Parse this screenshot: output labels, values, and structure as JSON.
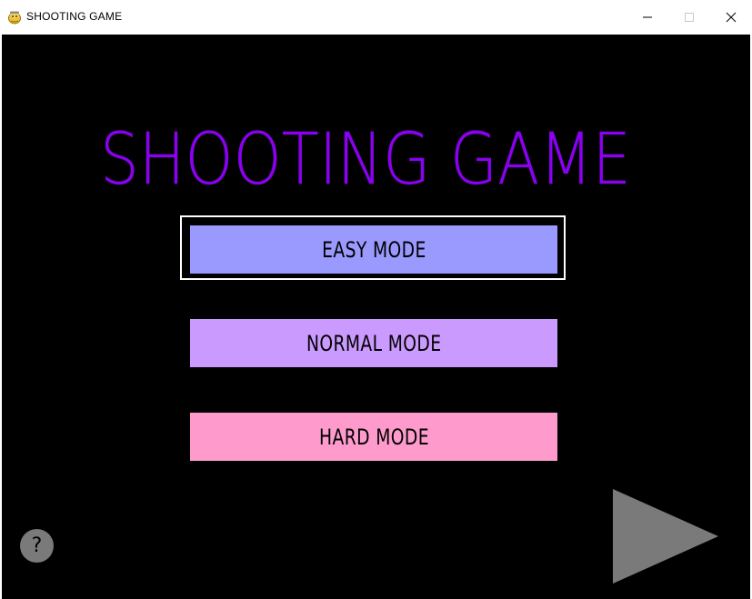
{
  "window": {
    "title": "SHOOTING GAME",
    "icon": "pygame-snake-icon",
    "controls": {
      "minimize": "minimize-icon",
      "maximize": "maximize-icon",
      "close": "close-icon"
    }
  },
  "game": {
    "title": "SHOOTING GAME",
    "title_color": "#8a00f0",
    "background": "#000000",
    "modes": [
      {
        "label": "EASY MODE",
        "color": "#9a99fe",
        "selected": true
      },
      {
        "label": "NORMAL MODE",
        "color": "#cb9afe",
        "selected": false
      },
      {
        "label": "HARD MODE",
        "color": "#fe9bcc",
        "selected": false
      }
    ],
    "help": {
      "label": "?",
      "icon": "help-icon",
      "color": "#7a7a7a"
    },
    "play": {
      "icon": "play-triangle-icon",
      "color": "#7a7a7a"
    },
    "selection_color": "#ffffff"
  }
}
